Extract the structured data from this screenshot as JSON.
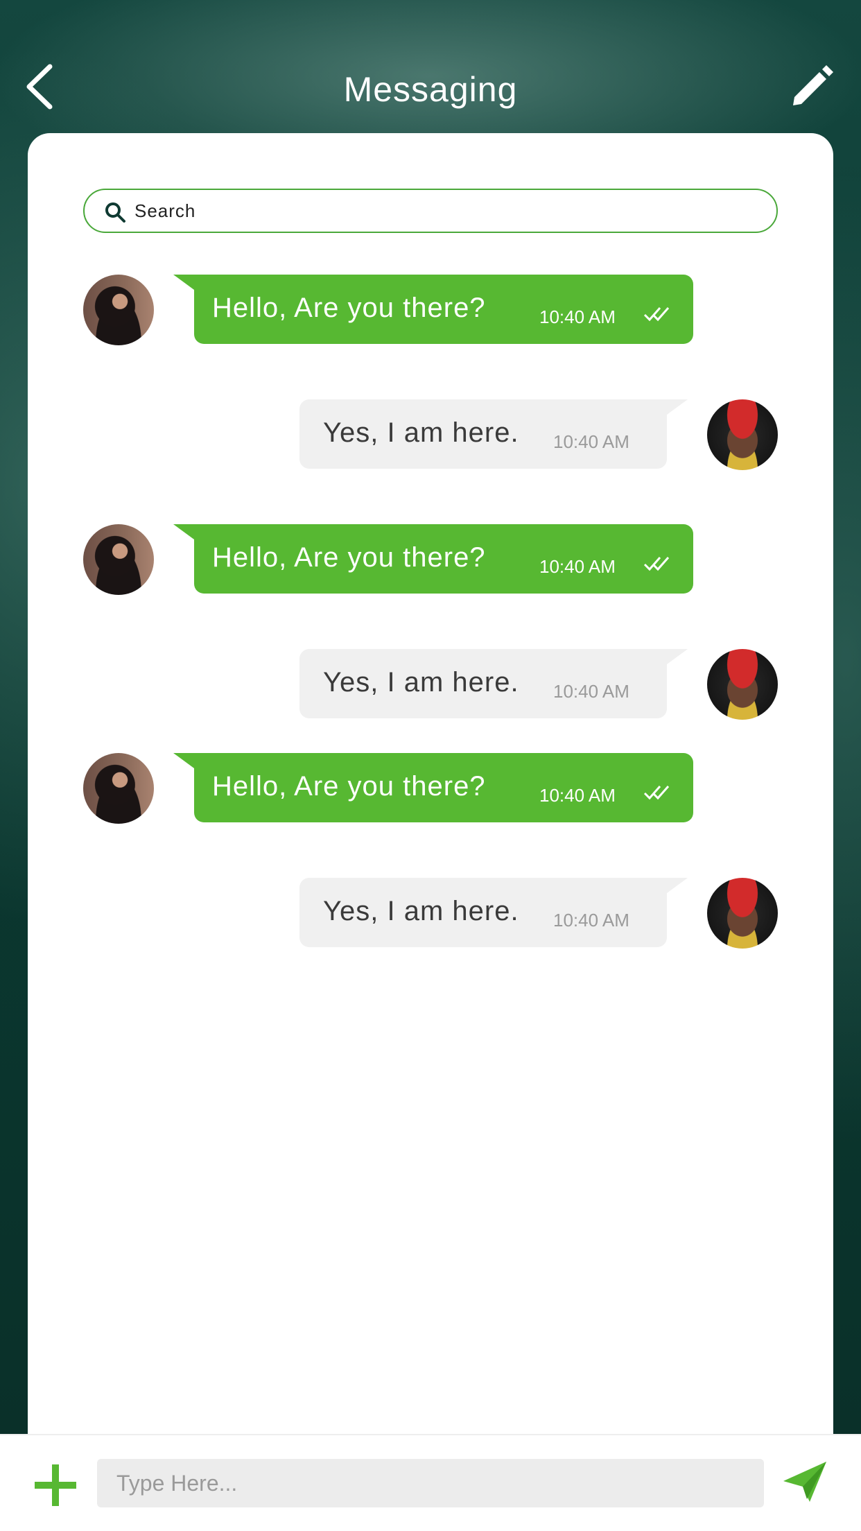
{
  "header": {
    "title": "Messaging",
    "back_icon": "chevron-left-icon",
    "edit_icon": "pencil-icon"
  },
  "search": {
    "placeholder": "Search",
    "icon": "search-icon"
  },
  "messages": [
    {
      "direction": "sent",
      "text": "Hello, Are you there?",
      "time": "10:40 AM",
      "status_icon": "double-check-icon",
      "avatar": "woman"
    },
    {
      "direction": "received",
      "text": "Yes, I am here.",
      "time": "10:40 AM",
      "avatar": "man"
    },
    {
      "direction": "sent",
      "text": "Hello, Are you there?",
      "time": "10:40 AM",
      "status_icon": "double-check-icon",
      "avatar": "woman"
    },
    {
      "direction": "received",
      "text": "Yes, I am here.",
      "time": "10:40 AM",
      "avatar": "man"
    },
    {
      "direction": "sent",
      "text": "Hello, Are you there?",
      "time": "10:40 AM",
      "status_icon": "double-check-icon",
      "avatar": "woman"
    },
    {
      "direction": "received",
      "text": "Yes, I am here.",
      "time": "10:40 AM",
      "avatar": "man"
    }
  ],
  "composer": {
    "placeholder": "Type Here...",
    "add_icon": "plus-icon",
    "send_icon": "paper-plane-icon"
  },
  "colors": {
    "accent": "#57b832",
    "header_bg": "#0f3a32",
    "received_bubble": "#f0f0f0"
  }
}
